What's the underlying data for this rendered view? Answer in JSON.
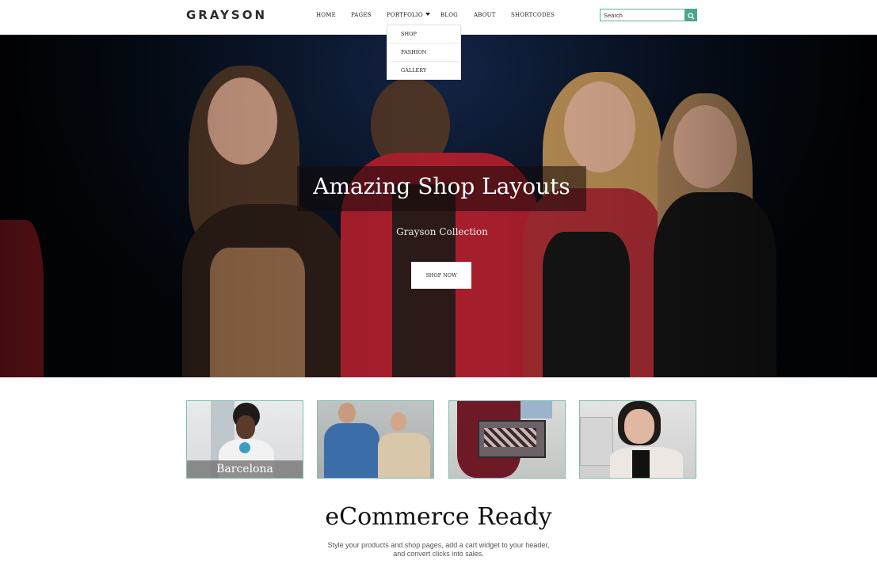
{
  "header": {
    "logo": "GRAYSON",
    "nav": [
      {
        "label": "HOME"
      },
      {
        "label": "PAGES"
      },
      {
        "label": "PORTFOLIO"
      },
      {
        "label": "BLOG"
      },
      {
        "label": "ABOUT"
      },
      {
        "label": "SHORTCODES"
      }
    ],
    "search": {
      "value": "Search",
      "icon": "search-icon"
    }
  },
  "dropdown": {
    "items": [
      "SHOP",
      "FASHION",
      "GALLERY"
    ]
  },
  "hero": {
    "title": "Amazing Shop Layouts",
    "subtitle": "Grayson Collection",
    "button": "SHOP NOW"
  },
  "thumbnails": [
    {
      "caption": "Barcelona"
    },
    {
      "caption": ""
    },
    {
      "caption": ""
    },
    {
      "caption": ""
    }
  ],
  "section": {
    "title": "eCommerce Ready",
    "text_line1": "Style your products and shop pages, add a cart widget to your header,",
    "text_line2": "and convert clicks into sales."
  },
  "colors": {
    "accent": "#4ca38e",
    "accent_border": "#59b39e"
  }
}
